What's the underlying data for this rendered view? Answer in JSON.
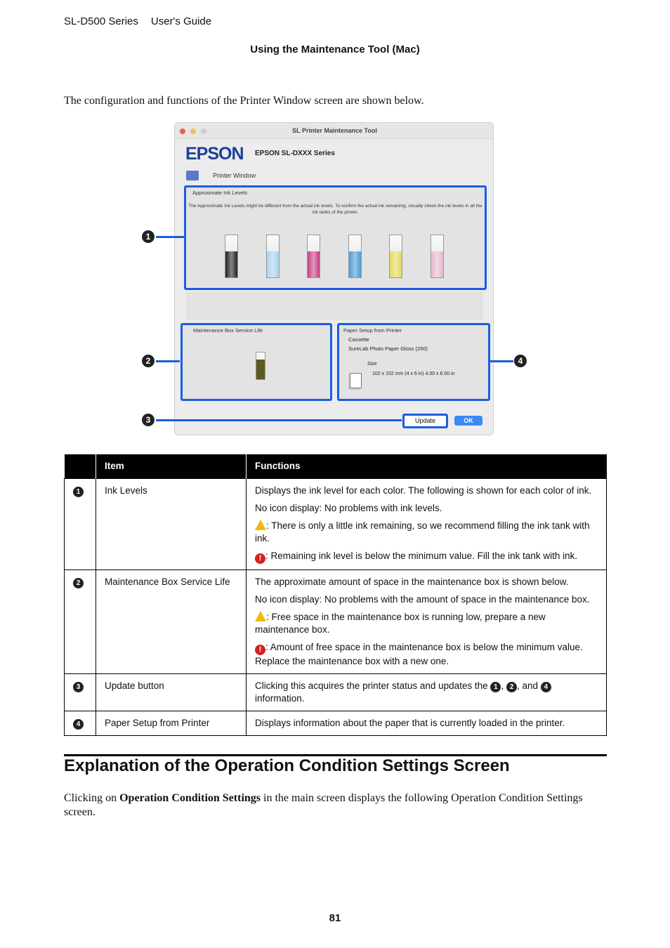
{
  "header": {
    "product": "SL-D500 Series",
    "guide": "User's Guide",
    "section": "Using the Maintenance Tool (Mac)"
  },
  "intro": "The configuration and functions of the Printer Window screen are shown below.",
  "figure": {
    "window_title": "SL Printer Maintenance Tool",
    "logo": "EPSON",
    "model": "EPSON SL-DXXX Series",
    "nav_label": "Printer Window",
    "ink_panel_title": "Approximate Ink Levels",
    "ink_note": "The Approximate Ink Levels might be different from the actual ink levels. To confirm the actual ink remaining, visually check the ink levels in all the ink tanks of the printer.",
    "inks": [
      {
        "color": "#222222",
        "level": 62
      },
      {
        "color": "#a9d3ee",
        "level": 62
      },
      {
        "color": "#c43f86",
        "level": 62
      },
      {
        "color": "#4a9ad4",
        "level": 62
      },
      {
        "color": "#e3d85a",
        "level": 62
      },
      {
        "color": "#e6b7cc",
        "level": 62
      }
    ],
    "maint_title": "Maintenance Box Service Life",
    "maint_level": 75,
    "maint_color": "#5e5a1e",
    "paper_title": "Paper Setup from Printer",
    "paper_source": "Cassette",
    "paper_type": "SureLab Photo Paper Gloss (250)",
    "size_label": "Size",
    "size_value": "102 x 152 mm (4 x 6 in) 4.00 x 6.00 in",
    "update": "Update",
    "ok": "OK",
    "callouts": [
      "1",
      "2",
      "3",
      "4"
    ],
    "accent": "#1a5de0"
  },
  "table": {
    "headers": [
      "",
      "Item",
      "Functions"
    ],
    "rows": [
      {
        "num": "1",
        "item": "Ink Levels",
        "lines": [
          "Displays the ink level for each color. The following is shown for each color of ink.",
          "No icon display: No problems with ink levels.",
          ": There is only a little ink remaining, so we recommend filling the ink tank with ink.",
          ": Remaining ink level is below the minimum value. Fill the ink tank with ink."
        ]
      },
      {
        "num": "2",
        "item": "Maintenance Box Service Life",
        "lines": [
          "The approximate amount of space in the maintenance box is shown below.",
          "No icon display: No problems with the amount of space in the maintenance box.",
          ": Free space in the maintenance box is running low, prepare a new maintenance box.",
          ": Amount of free space in the maintenance box is below the minimum value. Replace the maintenance box with a new one."
        ]
      },
      {
        "num": "3",
        "item": "Update button",
        "lines": [
          "Clicking this acquires the printer status and updates the",
          ",",
          ", and",
          "information."
        ]
      },
      {
        "num": "4",
        "item": "Paper Setup from Printer",
        "lines": [
          "Displays information about the paper that is currently loaded in the printer."
        ]
      }
    ]
  },
  "heading": "Explanation of the Operation Condition Settings Screen",
  "para": {
    "pre": "Clicking on ",
    "bold": "Operation Condition Settings",
    "post": " in the main screen displays the following Operation Condition Settings screen."
  },
  "page_number": "81"
}
